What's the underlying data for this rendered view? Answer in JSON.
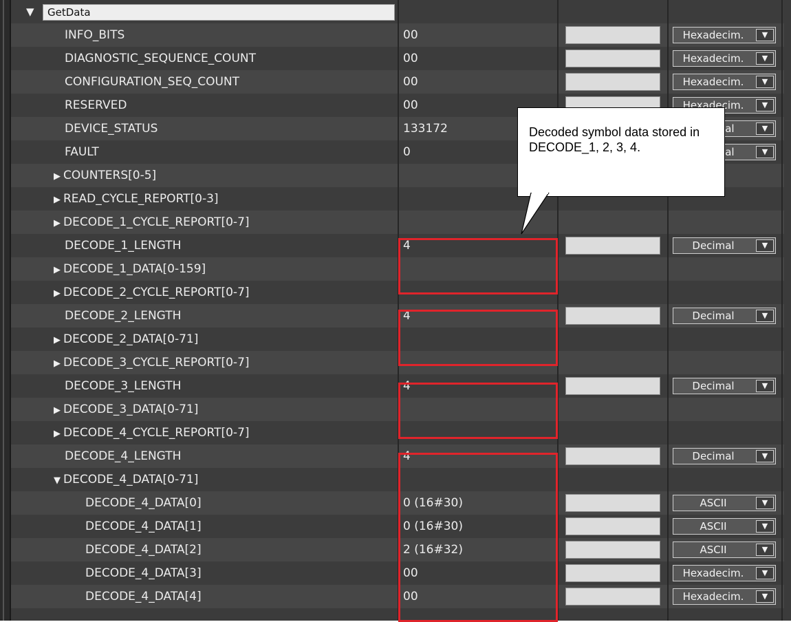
{
  "root": {
    "label": "GetData",
    "expanded": true
  },
  "rows": [
    {
      "name": "INFO_BITS",
      "value": "00",
      "format": "Hexadecim.",
      "level": 1,
      "kind": "leaf"
    },
    {
      "name": "DIAGNOSTIC_SEQUENCE_COUNT",
      "value": "00",
      "format": "Hexadecim.",
      "level": 1,
      "kind": "leaf"
    },
    {
      "name": "CONFIGURATION_SEQ_COUNT",
      "value": "00",
      "format": "Hexadecim.",
      "level": 1,
      "kind": "leaf"
    },
    {
      "name": "RESERVED",
      "value": "00",
      "format": "Hexadecim.",
      "level": 1,
      "kind": "leaf"
    },
    {
      "name": "DEVICE_STATUS",
      "value": "133172",
      "format": "Decimal",
      "level": 1,
      "kind": "leaf"
    },
    {
      "name": "FAULT",
      "value": "0",
      "format": "Decimal",
      "level": 1,
      "kind": "leaf"
    },
    {
      "name": "COUNTERS[0-5]",
      "value": "",
      "format": "",
      "level": 1,
      "kind": "collapsed"
    },
    {
      "name": "READ_CYCLE_REPORT[0-3]",
      "value": "",
      "format": "",
      "level": 1,
      "kind": "collapsed"
    },
    {
      "name": "DECODE_1_CYCLE_REPORT[0-7]",
      "value": "",
      "format": "",
      "level": 1,
      "kind": "collapsed"
    },
    {
      "name": "DECODE_1_LENGTH",
      "value": "4",
      "format": "Decimal",
      "level": 1,
      "kind": "leaf"
    },
    {
      "name": "DECODE_1_DATA[0-159]",
      "value": "",
      "format": "",
      "level": 1,
      "kind": "collapsed"
    },
    {
      "name": "DECODE_2_CYCLE_REPORT[0-7]",
      "value": "",
      "format": "",
      "level": 1,
      "kind": "collapsed"
    },
    {
      "name": "DECODE_2_LENGTH",
      "value": "4",
      "format": "Decimal",
      "level": 1,
      "kind": "leaf"
    },
    {
      "name": "DECODE_2_DATA[0-71]",
      "value": "",
      "format": "",
      "level": 1,
      "kind": "collapsed"
    },
    {
      "name": "DECODE_3_CYCLE_REPORT[0-7]",
      "value": "",
      "format": "",
      "level": 1,
      "kind": "collapsed"
    },
    {
      "name": "DECODE_3_LENGTH",
      "value": "4",
      "format": "Decimal",
      "level": 1,
      "kind": "leaf"
    },
    {
      "name": "DECODE_3_DATA[0-71]",
      "value": "",
      "format": "",
      "level": 1,
      "kind": "collapsed"
    },
    {
      "name": "DECODE_4_CYCLE_REPORT[0-7]",
      "value": "",
      "format": "",
      "level": 1,
      "kind": "collapsed"
    },
    {
      "name": "DECODE_4_LENGTH",
      "value": "4",
      "format": "Decimal",
      "level": 1,
      "kind": "leaf"
    },
    {
      "name": "DECODE_4_DATA[0-71]",
      "value": "",
      "format": "",
      "level": 1,
      "kind": "expanded"
    },
    {
      "name": "DECODE_4_DATA[0]",
      "value": "0 (16#30)",
      "format": "ASCII",
      "level": 2,
      "kind": "leaf"
    },
    {
      "name": "DECODE_4_DATA[1]",
      "value": "0 (16#30)",
      "format": "ASCII",
      "level": 2,
      "kind": "leaf"
    },
    {
      "name": "DECODE_4_DATA[2]",
      "value": "2 (16#32)",
      "format": "ASCII",
      "level": 2,
      "kind": "leaf"
    },
    {
      "name": "DECODE_4_DATA[3]",
      "value": "00",
      "format": "Hexadecim.",
      "level": 2,
      "kind": "leaf"
    },
    {
      "name": "DECODE_4_DATA[4]",
      "value": "00",
      "format": "Hexadecim.",
      "level": 2,
      "kind": "leaf"
    }
  ],
  "callout": {
    "text": "Decoded symbol data stored in DECODE_1, 2, 3, 4."
  },
  "colors": {
    "highlight": "#e0242b",
    "background": "#3b3b3b"
  }
}
